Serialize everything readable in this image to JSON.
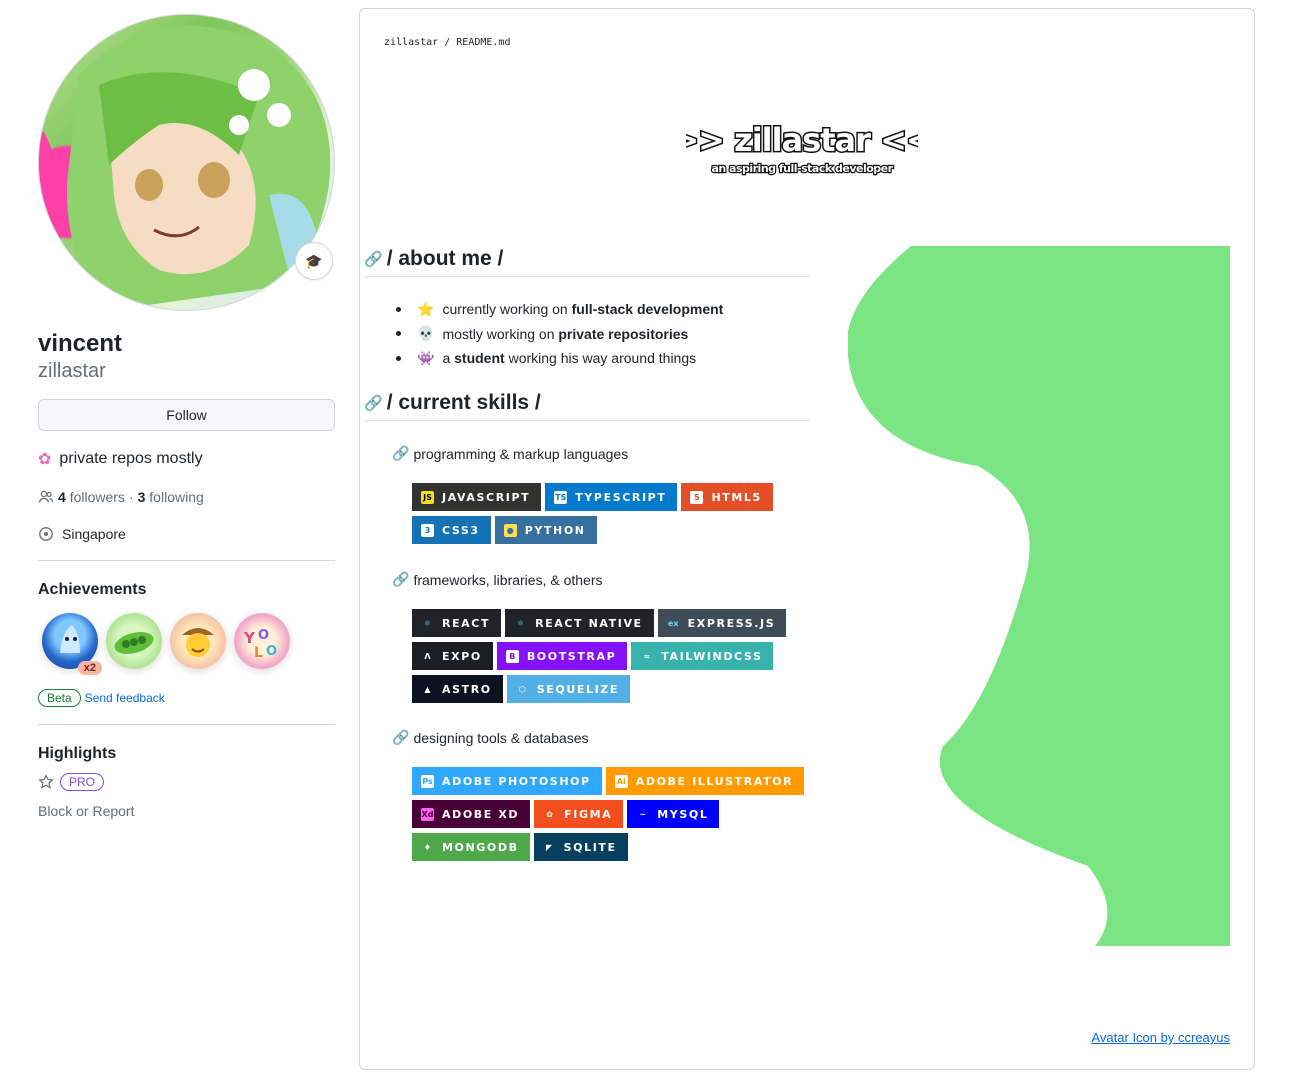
{
  "profile": {
    "name": "vincent",
    "login": "zillastar",
    "follow_label": "Follow",
    "bio": "private repos mostly",
    "followers_count": "4",
    "followers_label": "followers",
    "separator": "·",
    "following_count": "3",
    "following_label": "following",
    "location": "Singapore",
    "status_emoji": "🎓"
  },
  "achievements": {
    "title": "Achievements",
    "items": [
      {
        "name": "shark-achievement",
        "badge": "x2"
      },
      {
        "name": "pea-pod-achievement"
      },
      {
        "name": "cowboy-achievement"
      },
      {
        "name": "yolo-achievement"
      }
    ],
    "beta_label": "Beta",
    "feedback_label": "Send feedback"
  },
  "highlights": {
    "title": "Highlights",
    "pro_label": "PRO",
    "block_label": "Block or Report"
  },
  "readme": {
    "owner": "zillastar",
    "separator": "/",
    "file": "README.md",
    "banner_title": ">> zillastar <<",
    "banner_subtitle": "an aspiring full-stack developer",
    "about_heading": "/ about me /",
    "about_items": [
      {
        "emoji": "⭐",
        "pre": "currently working on",
        "bold": "full-stack development",
        "post": ""
      },
      {
        "emoji": "💀",
        "pre": "mostly working on",
        "bold": "private repositories",
        "post": ""
      },
      {
        "emoji": "👾",
        "pre": "a",
        "bold": "student",
        "post": "working his way around things"
      }
    ],
    "skills_heading": "/ current skills /",
    "groups": [
      {
        "title": "programming & markup languages",
        "rows": [
          [
            {
              "label": "JAVASCRIPT",
              "bg": "#323330",
              "icon": "JS",
              "icon_bg": "#f7df1e",
              "icon_fg": "#000"
            },
            {
              "label": "TYPESCRIPT",
              "bg": "#007acc",
              "icon": "TS",
              "icon_bg": "#ffffff",
              "icon_fg": "#007acc"
            },
            {
              "label": "HTML5",
              "bg": "#e34f26",
              "icon": "5",
              "icon_bg": "#ffffff",
              "icon_fg": "#e34f26"
            }
          ],
          [
            {
              "label": "CSS3",
              "bg": "#1572b6",
              "icon": "3",
              "icon_bg": "#ffffff",
              "icon_fg": "#1572b6"
            },
            {
              "label": "PYTHON",
              "bg": "#3670a0",
              "icon": "●",
              "icon_bg": "#ffdd54",
              "icon_fg": "#3670a0"
            }
          ]
        ]
      },
      {
        "title": "frameworks, libraries, & others",
        "rows": [
          [
            {
              "label": "REACT",
              "bg": "#20232a",
              "icon": "⚛",
              "icon_bg": "transparent",
              "icon_fg": "#61dafb"
            },
            {
              "label": "REACT NATIVE",
              "bg": "#20232a",
              "icon": "⚛",
              "icon_bg": "transparent",
              "icon_fg": "#61dafb"
            },
            {
              "label": "EXPRESS.JS",
              "bg": "#404d59",
              "icon": "ex",
              "icon_bg": "transparent",
              "icon_fg": "#61dafb"
            }
          ],
          [
            {
              "label": "EXPO",
              "bg": "#1c1e24",
              "icon": "Λ",
              "icon_bg": "transparent",
              "icon_fg": "#ffffff"
            },
            {
              "label": "BOOTSTRAP",
              "bg": "#8511fa",
              "icon": "B",
              "icon_bg": "#ffffff",
              "icon_fg": "#8511fa"
            },
            {
              "label": "TAILWINDCSS",
              "bg": "#38b2ac",
              "icon": "≈",
              "icon_bg": "transparent",
              "icon_fg": "#ffffff"
            }
          ],
          [
            {
              "label": "ASTRO",
              "bg": "#0c1222",
              "icon": "▲",
              "icon_bg": "transparent",
              "icon_fg": "#ffffff"
            },
            {
              "label": "SEQUELIZE",
              "bg": "#52b0e7",
              "icon": "⬡",
              "icon_bg": "transparent",
              "icon_fg": "#ffffff"
            }
          ]
        ]
      },
      {
        "title": "designing tools & databases",
        "rows": [
          [
            {
              "label": "ADOBE PHOTOSHOP",
              "bg": "#31a8ff",
              "icon": "Ps",
              "icon_bg": "#ffffff",
              "icon_fg": "#31a8ff"
            },
            {
              "label": "ADOBE ILLUSTRATOR",
              "bg": "#ff9a00",
              "icon": "Ai",
              "icon_bg": "#ffffff",
              "icon_fg": "#ff9a00"
            }
          ],
          [
            {
              "label": "ADOBE XD",
              "bg": "#470137",
              "icon": "Xd",
              "icon_bg": "#ff61f6",
              "icon_fg": "#470137"
            },
            {
              "label": "FIGMA",
              "bg": "#f24e1e",
              "icon": "✿",
              "icon_bg": "transparent",
              "icon_fg": "#ffffff"
            },
            {
              "label": "MYSQL",
              "bg": "#00f",
              "icon": "~",
              "icon_bg": "transparent",
              "icon_fg": "#ffffff"
            }
          ],
          [
            {
              "label": "MONGODB",
              "bg": "#4ea94b",
              "icon": "♦",
              "icon_bg": "transparent",
              "icon_fg": "#ffffff"
            },
            {
              "label": "SQLITE",
              "bg": "#07405e",
              "icon": "◤",
              "icon_bg": "transparent",
              "icon_fg": "#ffffff"
            }
          ]
        ]
      }
    ],
    "credit_label": "Avatar Icon by ccreayus",
    "wave_color": "#7ae582"
  }
}
